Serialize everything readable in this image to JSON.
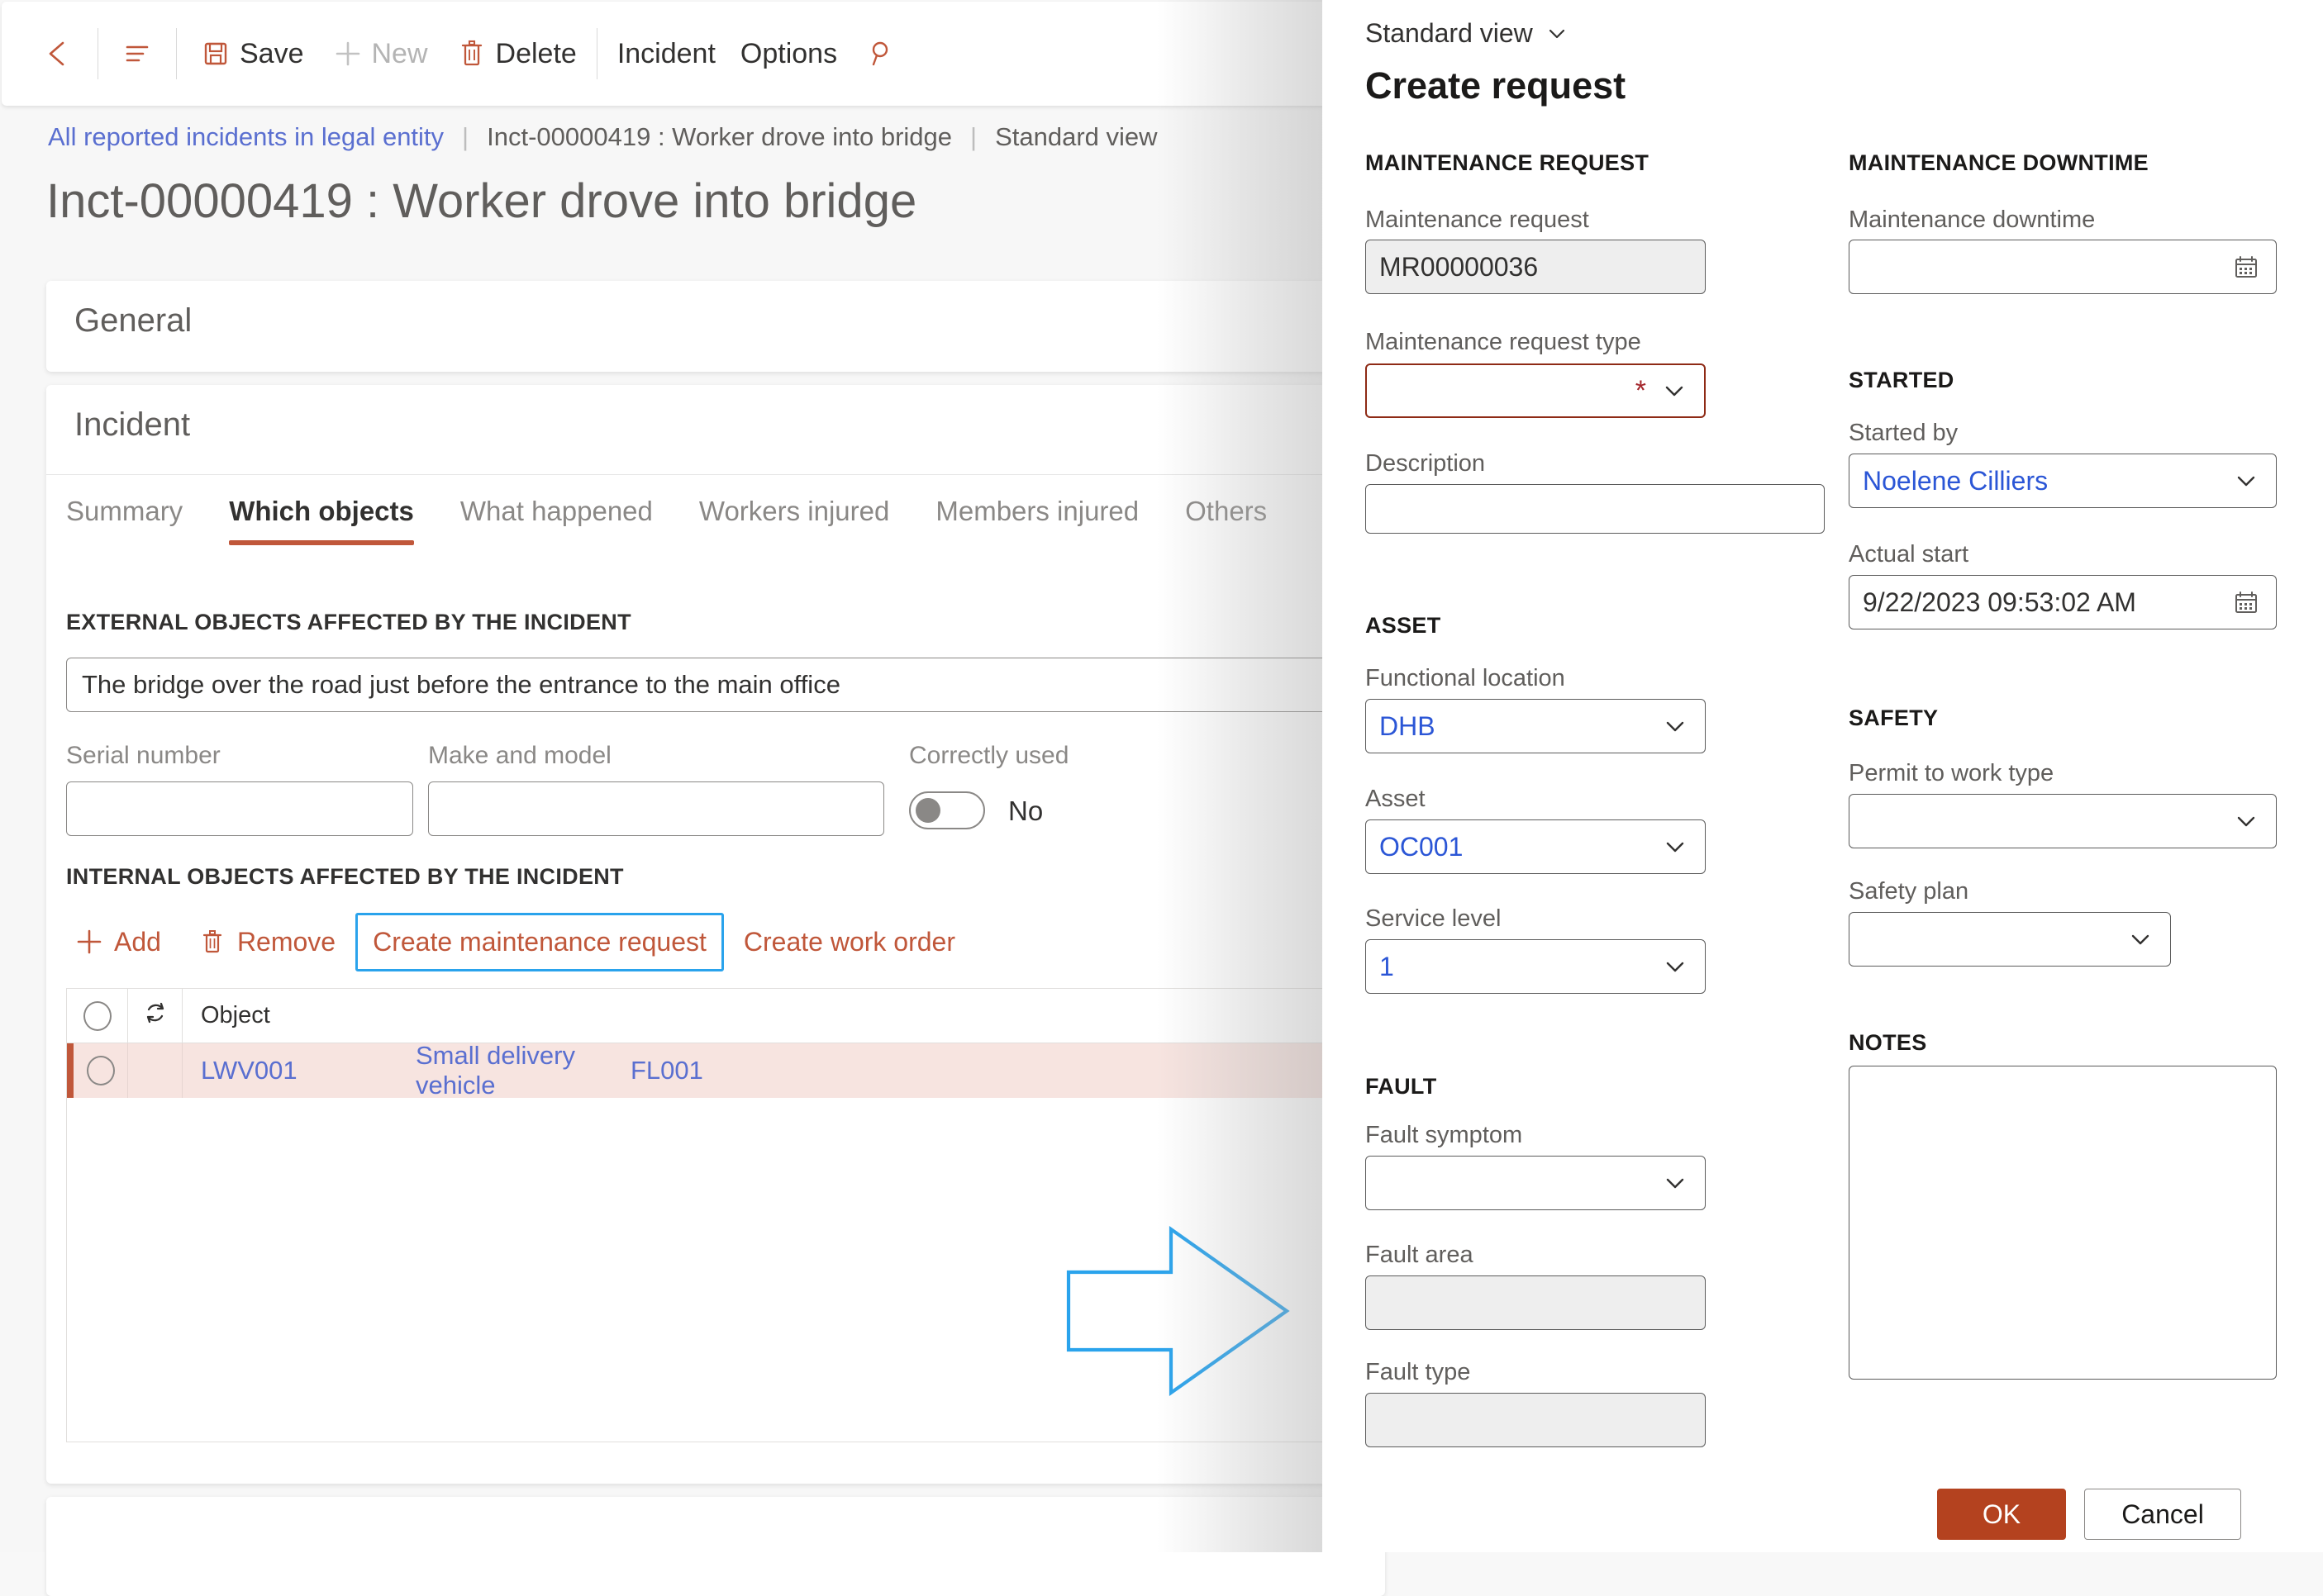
{
  "commandbar": {
    "back_icon": "back-arrow-icon",
    "menu_icon": "show-hide-navigation-icon",
    "save_label": "Save",
    "new_label": "New",
    "delete_label": "Delete",
    "incident_label": "Incident",
    "options_label": "Options",
    "search_icon": "search-icon"
  },
  "breadcrumb": {
    "link": "All reported incidents in legal entity",
    "separator": "|",
    "record": "Inct-00000419 : Worker drove into bridge",
    "view": "Standard view"
  },
  "page": {
    "title": "Inct-00000419 : Worker drove into bridge",
    "general_card_title": "General",
    "incident_card_title": "Incident"
  },
  "tabs": [
    {
      "label": "Summary",
      "active": false
    },
    {
      "label": "Which objects",
      "active": true
    },
    {
      "label": "What happened",
      "active": false
    },
    {
      "label": "Workers injured",
      "active": false
    },
    {
      "label": "Members injured",
      "active": false
    },
    {
      "label": "Others",
      "active": false
    }
  ],
  "external_objects": {
    "section_caption": "EXTERNAL OBJECTS AFFECTED BY THE INCIDENT",
    "description_value": "The bridge over the road just before the entrance to the main office",
    "serial_number_label": "Serial number",
    "serial_number_value": "",
    "make_model_label": "Make and model",
    "make_model_value": "",
    "correctly_used_label": "Correctly used",
    "correctly_used_value": "No"
  },
  "internal_objects": {
    "section_caption": "INTERNAL OBJECTS AFFECTED BY THE INCIDENT",
    "actions": {
      "add_label": "Add",
      "remove_label": "Remove",
      "create_maintenance_request_label": "Create maintenance request",
      "create_work_order_label": "Create work order"
    },
    "grid": {
      "columns": [
        "",
        "",
        "Object",
        "",
        ""
      ],
      "object_header": "Object",
      "rows": [
        {
          "object": "LWV001",
          "name": "Small delivery vehicle",
          "location": "FL001"
        }
      ]
    }
  },
  "dialog": {
    "view_selector": "Standard view",
    "title": "Create request",
    "sections": {
      "maintenance_request": "MAINTENANCE REQUEST",
      "asset": "ASSET",
      "fault": "FAULT",
      "maintenance_downtime": "MAINTENANCE DOWNTIME",
      "started": "STARTED",
      "safety": "SAFETY",
      "notes": "NOTES"
    },
    "fields": {
      "maintenance_request_label": "Maintenance request",
      "maintenance_request_value": "MR00000036",
      "maintenance_request_type_label": "Maintenance request type",
      "maintenance_request_type_value": "",
      "description_label": "Description",
      "description_value": "",
      "functional_location_label": "Functional location",
      "functional_location_value": "DHB",
      "asset_label": "Asset",
      "asset_value": "OC001",
      "service_level_label": "Service level",
      "service_level_value": "1",
      "fault_symptom_label": "Fault symptom",
      "fault_symptom_value": "",
      "fault_area_label": "Fault area",
      "fault_area_value": "",
      "fault_type_label": "Fault type",
      "fault_type_value": "",
      "maintenance_downtime_label": "Maintenance downtime",
      "maintenance_downtime_value": "",
      "started_by_label": "Started by",
      "started_by_value": "Noelene Cilliers",
      "actual_start_label": "Actual start",
      "actual_start_value": "9/22/2023 09:53:02 AM",
      "permit_to_work_type_label": "Permit to work type",
      "permit_to_work_type_value": "",
      "safety_plan_label": "Safety plan",
      "safety_plan_value": "",
      "notes_value": ""
    },
    "buttons": {
      "ok_label": "OK",
      "cancel_label": "Cancel"
    }
  },
  "annotation": {
    "arrow": "right-arrow-annotation",
    "arrow_color": "#2aa3ec"
  },
  "colors": {
    "accent": "#c0573a",
    "primary_button": "#b4421f",
    "link": "#5a6fd0",
    "dialog_link": "#2b56d6",
    "required_border": "#8e2a15",
    "row_highlight": "#f7e4e0",
    "focus_outline": "#2aa3ec"
  }
}
